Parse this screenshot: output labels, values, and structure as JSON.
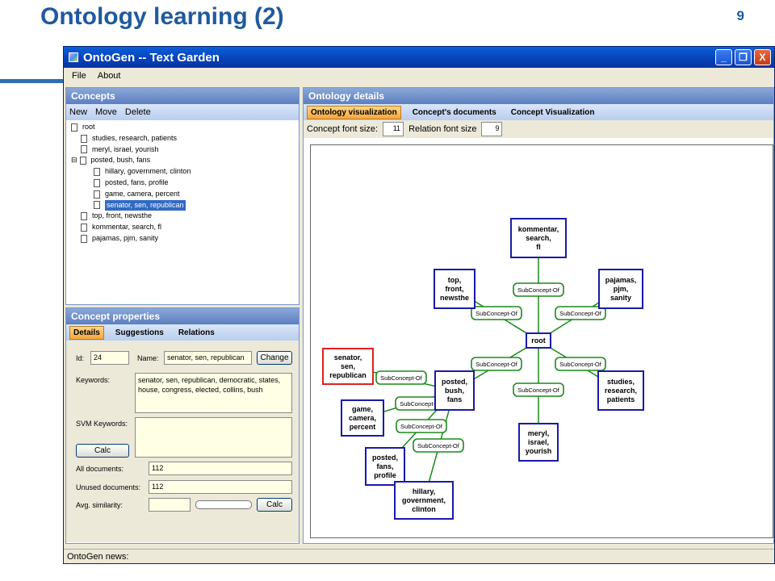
{
  "slide": {
    "title": "Ontology learning (2)",
    "number": "9"
  },
  "window": {
    "title": "OntoGen -- Text Garden",
    "min": "_",
    "max": "❐",
    "close": "X"
  },
  "menu": [
    "File",
    "About"
  ],
  "concepts": {
    "header": "Concepts",
    "toolbar": [
      "New",
      "Move",
      "Delete"
    ],
    "tree": [
      {
        "label": "root",
        "level": 0
      },
      {
        "label": "studies, research, patients",
        "level": 1
      },
      {
        "label": "meryl, israel, yourish",
        "level": 1
      },
      {
        "label": "posted, bush, fans",
        "level": 1,
        "expander": "⊟"
      },
      {
        "label": "hillary, government, clinton",
        "level": 2
      },
      {
        "label": "posted, fans, profile",
        "level": 2
      },
      {
        "label": "game, camera, percent",
        "level": 2
      },
      {
        "label": "senator, sen, republican",
        "level": 2,
        "selected": true
      },
      {
        "label": "top, front, newsthe",
        "level": 1
      },
      {
        "label": "kommentar, search, fl",
        "level": 1
      },
      {
        "label": "pajamas, pjm, sanity",
        "level": 1
      }
    ]
  },
  "properties": {
    "header": "Concept properties",
    "tabs": [
      "Details",
      "Suggestions",
      "Relations"
    ],
    "id_label": "Id:",
    "id_value": "24",
    "name_label": "Name:",
    "name_value": "senator, sen, republican",
    "change_button": "Change",
    "keywords_label": "Keywords:",
    "keywords_value": "senator, sen, republican, democratic, states, house, congress, elected, collins, bush",
    "svm_label": "SVM Keywords:",
    "calc_button": "Calc",
    "all_docs_label": "All documents:",
    "all_docs_value": "112",
    "unused_docs_label": "Unused documents:",
    "unused_docs_value": "112",
    "avg_sim_label": "Avg. similarity:",
    "calc_button2": "Calc"
  },
  "details": {
    "header": "Ontology details",
    "tabs": [
      "Ontology visualization",
      "Concept's documents",
      "Concept Visualization"
    ],
    "concept_font_label": "Concept font size:",
    "concept_font_value": "11",
    "relation_font_label": "Relation font size",
    "relation_font_value": "9"
  },
  "graph": {
    "edge_label": "SubConcept-Of",
    "nodes": {
      "root": [
        "root"
      ],
      "kommentar": [
        "kommentar,",
        "search,",
        "fl"
      ],
      "top": [
        "top,",
        "front,",
        "newsthe"
      ],
      "pajamas": [
        "pajamas,",
        "pjm,",
        "sanity"
      ],
      "senator": [
        "senator,",
        "sen,",
        "republican"
      ],
      "posted": [
        "posted,",
        "bush,",
        "fans"
      ],
      "studies": [
        "studies,",
        "research,",
        "patients"
      ],
      "game": [
        "game,",
        "camera,",
        "percent"
      ],
      "meryl": [
        "meryl,",
        "israel,",
        "yourish"
      ],
      "postedfans": [
        "posted,",
        "fans,",
        "profile"
      ],
      "hillary": [
        "hillary,",
        "government,",
        "clinton"
      ]
    },
    "colors": {
      "node": "#1a1aa8",
      "selected": "#e02020",
      "relation": "#1a8a1a"
    }
  },
  "status": {
    "label": "OntoGen news:"
  }
}
